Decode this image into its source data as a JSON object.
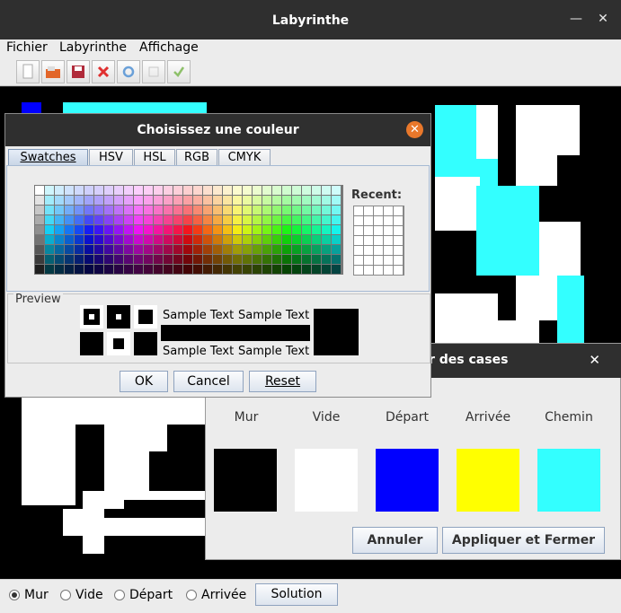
{
  "window": {
    "title": "Labyrinthe"
  },
  "menu": {
    "items": [
      "Fichier",
      "Labyrinthe",
      "Affichage"
    ]
  },
  "toolbar": {
    "icons": [
      "new-file-icon",
      "open-folder-icon",
      "save-icon",
      "delete-icon",
      "refresh-icon",
      "blank-icon",
      "check-icon"
    ]
  },
  "bottom": {
    "radios": [
      {
        "label": "Mur",
        "selected": true
      },
      {
        "label": "Vide",
        "selected": false
      },
      {
        "label": "Départ",
        "selected": false
      },
      {
        "label": "Arrivée",
        "selected": false
      }
    ],
    "solution_label": "Solution"
  },
  "cell_dialog": {
    "title": "r des cases",
    "labels": [
      "Mur",
      "Vide",
      "Départ",
      "Arrivée",
      "Chemin"
    ],
    "colors": [
      "#000000",
      "#ffffff",
      "#0000ff",
      "#ffff00",
      "#33ffff"
    ],
    "cancel_label": "Annuler",
    "apply_label": "Appliquer et Fermer"
  },
  "color_dialog": {
    "title": "Choisissez une couleur",
    "tabs": [
      "Swatches",
      "HSV",
      "HSL",
      "RGB",
      "CMYK"
    ],
    "recent_label": "Recent:",
    "preview_label": "Preview",
    "sample_text": "Sample Text",
    "ok_label": "OK",
    "cancel_label": "Cancel",
    "reset_label": "Reset"
  },
  "colors": {
    "maze_wall": "#000000",
    "maze_empty": "#ffffff",
    "maze_path": "#33ffff",
    "maze_start": "#0000ff"
  }
}
